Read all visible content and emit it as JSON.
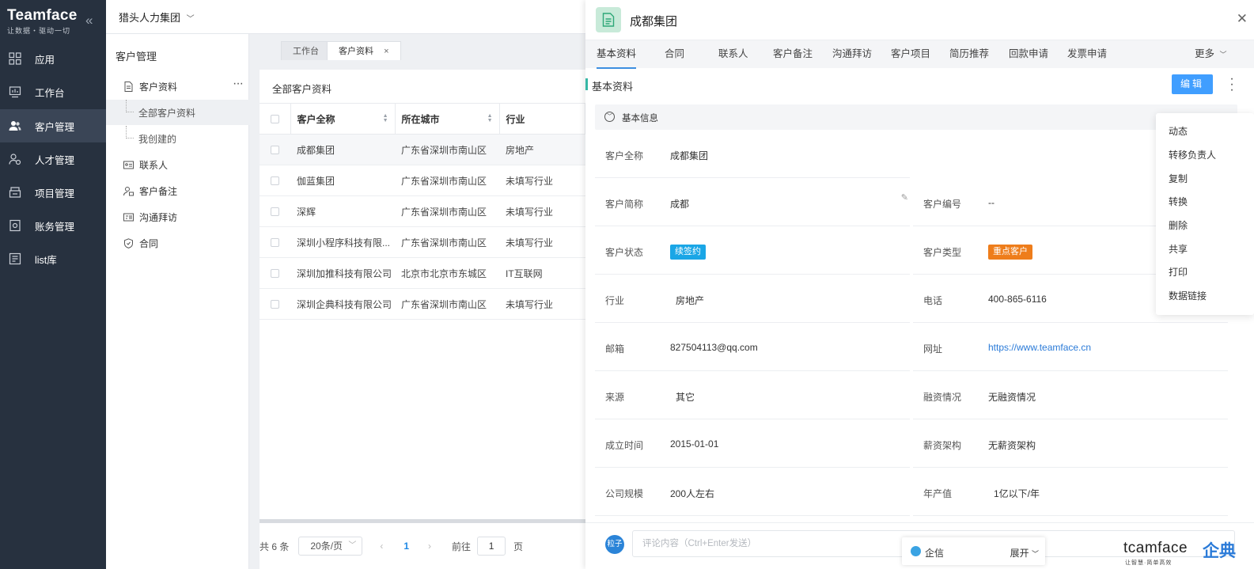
{
  "brand": {
    "name": "Teamface",
    "slogan": "让数据・驱动一切"
  },
  "sidebar": {
    "items": [
      {
        "label": "应用",
        "icon": "apps-icon"
      },
      {
        "label": "工作台",
        "icon": "workbench-icon"
      },
      {
        "label": "客户管理",
        "icon": "customers-icon",
        "active": true
      },
      {
        "label": "人才管理",
        "icon": "talent-icon"
      },
      {
        "label": "项目管理",
        "icon": "project-icon"
      },
      {
        "label": "账务管理",
        "icon": "finance-icon"
      },
      {
        "label": "list库",
        "icon": "list-icon"
      }
    ]
  },
  "topbar": {
    "company": "猎头人力集团"
  },
  "module": {
    "title": "客户管理",
    "tree": [
      {
        "label": "客户资料"
      },
      {
        "label": "全部客户资料"
      },
      {
        "label": "我创建的"
      },
      {
        "label": "联系人"
      },
      {
        "label": "客户备注"
      },
      {
        "label": "沟通拜访"
      },
      {
        "label": "合同"
      }
    ]
  },
  "tabs": [
    {
      "label": "工作台"
    },
    {
      "label": "客户资料"
    }
  ],
  "list": {
    "title": "全部客户资料",
    "columns": [
      "客户全称",
      "所在城市",
      "行业"
    ],
    "rows": [
      [
        "成都集团",
        "广东省深圳市南山区",
        "房地产"
      ],
      [
        "伽蓝集团",
        "广东省深圳市南山区",
        "未填写行业"
      ],
      [
        "深辉",
        "广东省深圳市南山区",
        "未填写行业"
      ],
      [
        "深圳小程序科技有限...",
        "广东省深圳市南山区",
        "未填写行业"
      ],
      [
        "深圳加推科技有限公司",
        "北京市北京市东城区",
        "IT互联网"
      ],
      [
        "深圳企典科技有限公司",
        "广东省深圳市南山区",
        "未填写行业"
      ]
    ]
  },
  "pager": {
    "total": "共 6 条",
    "per_page": "20条/页",
    "current": "1",
    "goto_label": "前往",
    "goto_value": "1",
    "page_unit": "页"
  },
  "drawer": {
    "title": "成都集团",
    "tabs": [
      "基本资料",
      "合同",
      "联系人",
      "客户备注",
      "沟通拜访",
      "客户项目",
      "简历推荐",
      "回款申请",
      "发票申请"
    ],
    "more": "更多",
    "section_bar": "基本资料",
    "edit": "编辑",
    "section": "基本信息",
    "fields": {
      "full_name": {
        "label": "客户全称",
        "value": "成都集团"
      },
      "short_name": {
        "label": "客户简称",
        "value": "成都"
      },
      "code": {
        "label": "客户编号",
        "value": "--"
      },
      "status": {
        "label": "客户状态",
        "value": "续签约",
        "color": "#1aa6e6"
      },
      "type": {
        "label": "客户类型",
        "value": "重点客户",
        "color": "#ee7d1b"
      },
      "industry": {
        "label": "行业",
        "value": "房地产"
      },
      "phone": {
        "label": "电话",
        "value": "400-865-6116"
      },
      "email": {
        "label": "邮箱",
        "value": "827504113@qq.com"
      },
      "website": {
        "label": "网址",
        "value": "https://www.teamface.cn"
      },
      "source": {
        "label": "来源",
        "value": "其它"
      },
      "financing": {
        "label": "融资情况",
        "value": "无融资情况"
      },
      "founded": {
        "label": "成立时间",
        "value": "2015-01-01"
      },
      "salary": {
        "label": "薪资架构",
        "value": "无薪资架构"
      },
      "scale": {
        "label": "公司规模",
        "value": "200人左右"
      },
      "output": {
        "label": "年产值",
        "value": "1亿以下/年"
      }
    },
    "comment": {
      "avatar": "粒子",
      "placeholder": "评论内容（Ctrl+Enter发送）"
    },
    "qixin": {
      "label": "企信",
      "expand": "展开"
    },
    "footer_logo": {
      "word": "tcamface",
      "cn": "企典",
      "slogan": "让智慧·简单高效"
    }
  },
  "menu": {
    "items": [
      "动态",
      "转移负责人",
      "复制",
      "转换",
      "删除",
      "共享",
      "打印",
      "数据链接"
    ]
  }
}
